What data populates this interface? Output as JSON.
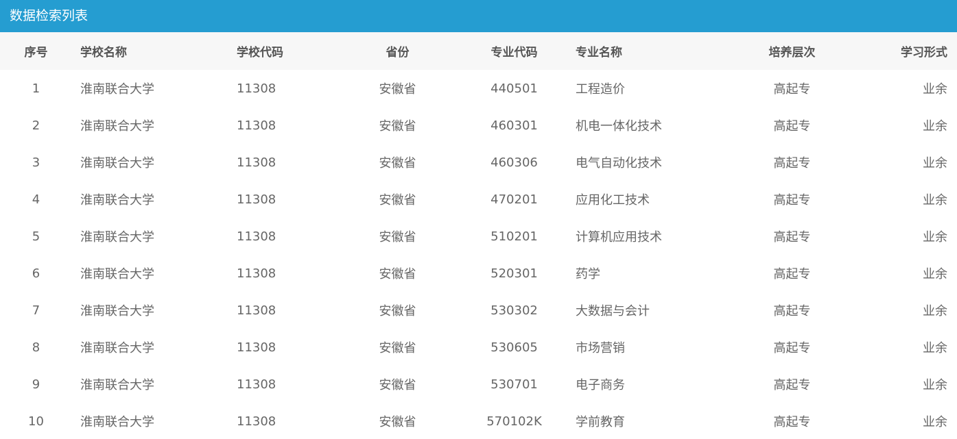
{
  "panel": {
    "title": "数据检索列表"
  },
  "table": {
    "columns": [
      "序号",
      "学校名称",
      "学校代码",
      "省份",
      "专业代码",
      "专业名称",
      "培养层次",
      "学习形式"
    ],
    "rows": [
      [
        "1",
        "淮南联合大学",
        "11308",
        "安徽省",
        "440501",
        "工程造价",
        "高起专",
        "业余"
      ],
      [
        "2",
        "淮南联合大学",
        "11308",
        "安徽省",
        "460301",
        "机电一体化技术",
        "高起专",
        "业余"
      ],
      [
        "3",
        "淮南联合大学",
        "11308",
        "安徽省",
        "460306",
        "电气自动化技术",
        "高起专",
        "业余"
      ],
      [
        "4",
        "淮南联合大学",
        "11308",
        "安徽省",
        "470201",
        "应用化工技术",
        "高起专",
        "业余"
      ],
      [
        "5",
        "淮南联合大学",
        "11308",
        "安徽省",
        "510201",
        "计算机应用技术",
        "高起专",
        "业余"
      ],
      [
        "6",
        "淮南联合大学",
        "11308",
        "安徽省",
        "520301",
        "药学",
        "高起专",
        "业余"
      ],
      [
        "7",
        "淮南联合大学",
        "11308",
        "安徽省",
        "530302",
        "大数据与会计",
        "高起专",
        "业余"
      ],
      [
        "8",
        "淮南联合大学",
        "11308",
        "安徽省",
        "530605",
        "市场营销",
        "高起专",
        "业余"
      ],
      [
        "9",
        "淮南联合大学",
        "11308",
        "安徽省",
        "530701",
        "电子商务",
        "高起专",
        "业余"
      ],
      [
        "10",
        "淮南联合大学",
        "11308",
        "安徽省",
        "570102K",
        "学前教育",
        "高起专",
        "业余"
      ]
    ]
  }
}
